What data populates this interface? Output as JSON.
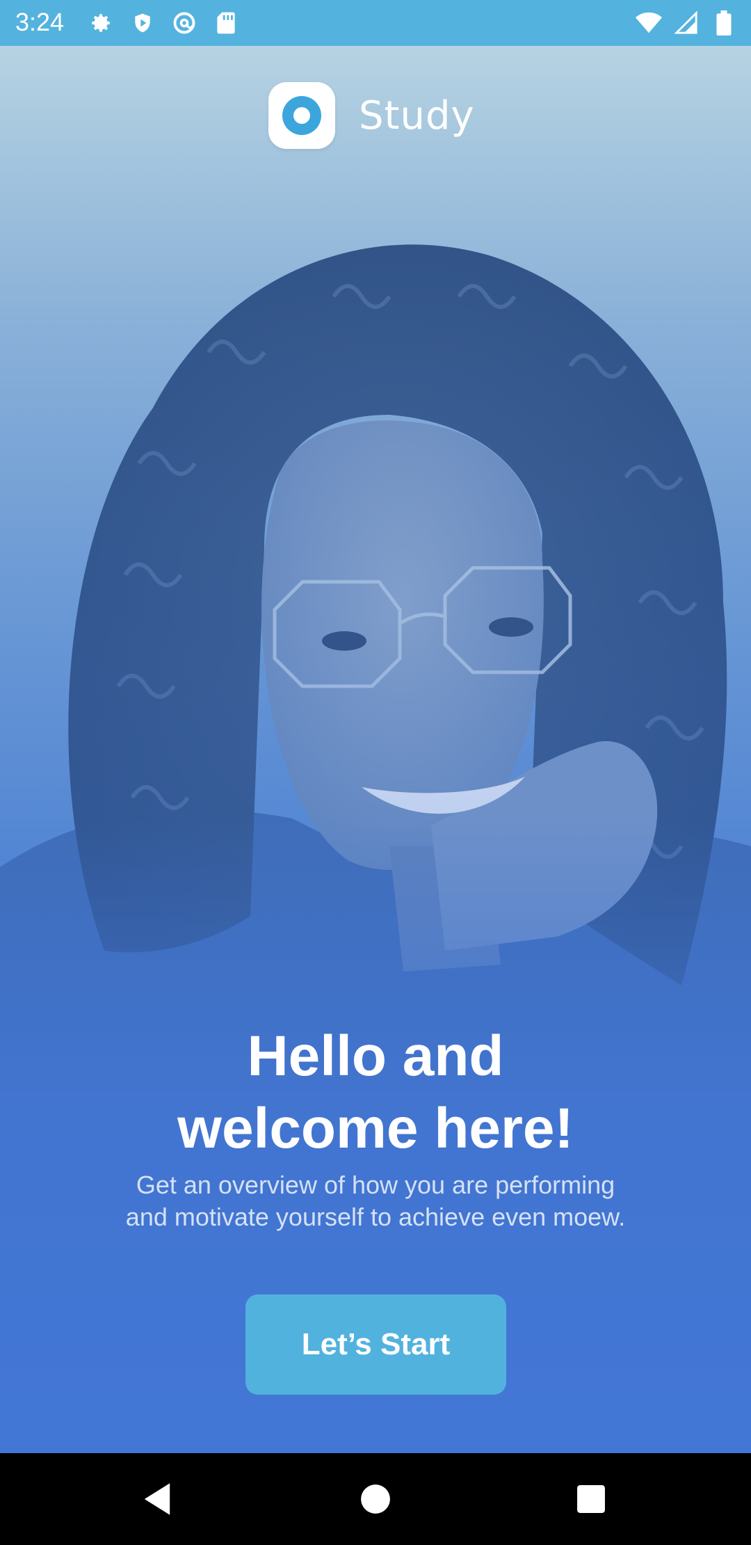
{
  "status_bar": {
    "time": "3:24",
    "left_icons": [
      "settings-icon",
      "shield-play-icon",
      "at-sign-icon",
      "sd-card-icon"
    ],
    "right_icons": [
      "wifi-icon",
      "cellular-signal-icon",
      "battery-icon"
    ],
    "background": "#54b3de"
  },
  "app": {
    "name": "Study",
    "logo_icon": "study-logo-icon"
  },
  "welcome": {
    "title_line1": "Hello and",
    "title_line2": "welcome here!",
    "subtitle_line1": "Get an overview of how you are performing",
    "subtitle_line2": "and motivate yourself to achieve even moew.",
    "cta_label": "Let’s Start"
  },
  "colors": {
    "accent": "#52b2de",
    "overlay_bottom": "#4377d6",
    "overlay_top": "#b6d3e2"
  },
  "nav_bar": {
    "buttons": [
      "back-icon",
      "home-icon",
      "recents-icon"
    ]
  }
}
